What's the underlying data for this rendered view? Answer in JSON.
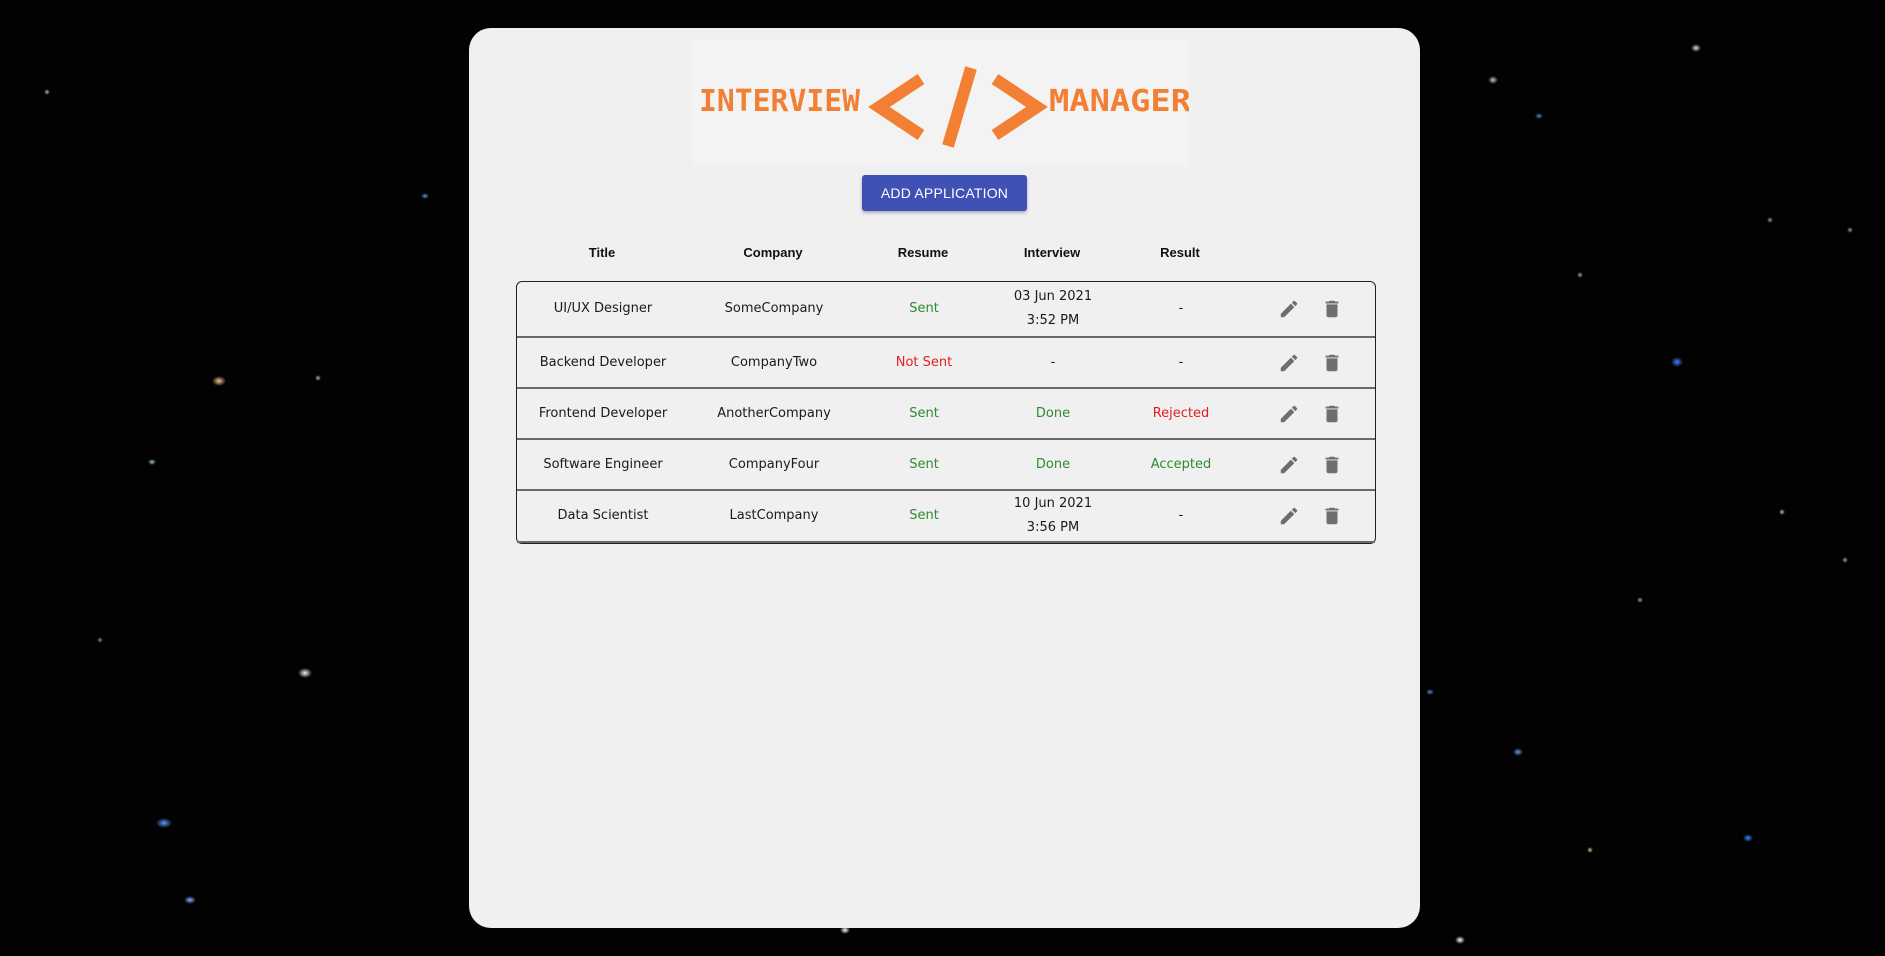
{
  "logo": {
    "left_word": "INTERVIEW",
    "right_word": "MANAGER",
    "accent_color": "#f27f33"
  },
  "toolbar": {
    "add_label": "ADD APPLICATION",
    "button_color": "#3f51b5"
  },
  "table": {
    "headers": [
      "Title",
      "Company",
      "Resume",
      "Interview",
      "Result"
    ],
    "rows": [
      {
        "title": "UI/UX Designer",
        "company": "SomeCompany",
        "resume": "Sent",
        "interview_date": "03 Jun 2021",
        "interview_time": "3:52 PM",
        "result": "-"
      },
      {
        "title": "Backend Developer",
        "company": "CompanyTwo",
        "resume": "Not Sent",
        "interview_date": "-",
        "interview_time": "",
        "result": "-"
      },
      {
        "title": "Frontend Developer",
        "company": "AnotherCompany",
        "resume": "Sent",
        "interview_date": "Done",
        "interview_time": "",
        "result": "Rejected"
      },
      {
        "title": "Software Engineer",
        "company": "CompanyFour",
        "resume": "Sent",
        "interview_date": "Done",
        "interview_time": "",
        "result": "Accepted"
      },
      {
        "title": "Data Scientist",
        "company": "LastCompany",
        "resume": "Sent",
        "interview_date": "10 Jun 2021",
        "interview_time": "3:56 PM",
        "result": "-"
      }
    ]
  },
  "icons": {
    "edit": "pencil-icon",
    "delete": "trash-icon"
  },
  "colors": {
    "positive": "#2e8b2e",
    "negative": "#e02020",
    "icon": "#6e6e6e"
  }
}
